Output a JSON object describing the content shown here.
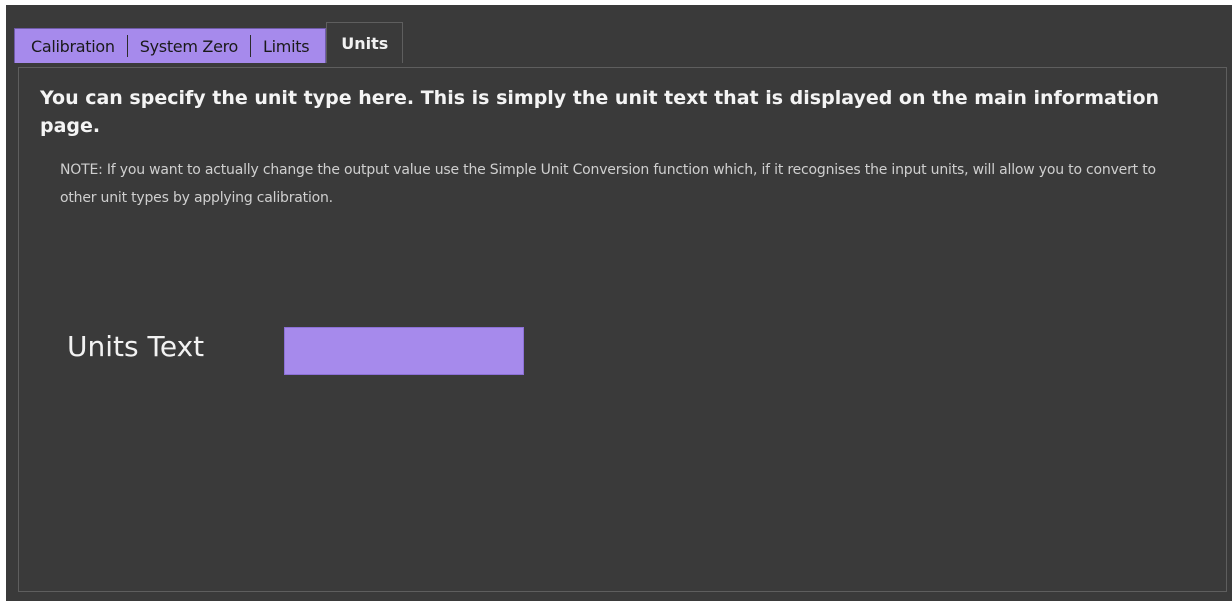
{
  "tabs": [
    {
      "label": "Calibration"
    },
    {
      "label": "System Zero"
    },
    {
      "label": "Limits"
    },
    {
      "label": "Units",
      "active": true
    }
  ],
  "content": {
    "headline": "You can specify the unit type here. This is simply the unit text that is displayed on the main information page.",
    "note": "NOTE: If you want to actually change the output value use the Simple Unit Conversion function which, if it recognises the input units, will allow you to convert to other unit types by applying calibration."
  },
  "units_field": {
    "label": "Units Text",
    "value": "",
    "placeholder": ""
  },
  "colors": {
    "accent": "#a68aec",
    "background": "#3a3a3a",
    "text": "#f2f2f2"
  }
}
